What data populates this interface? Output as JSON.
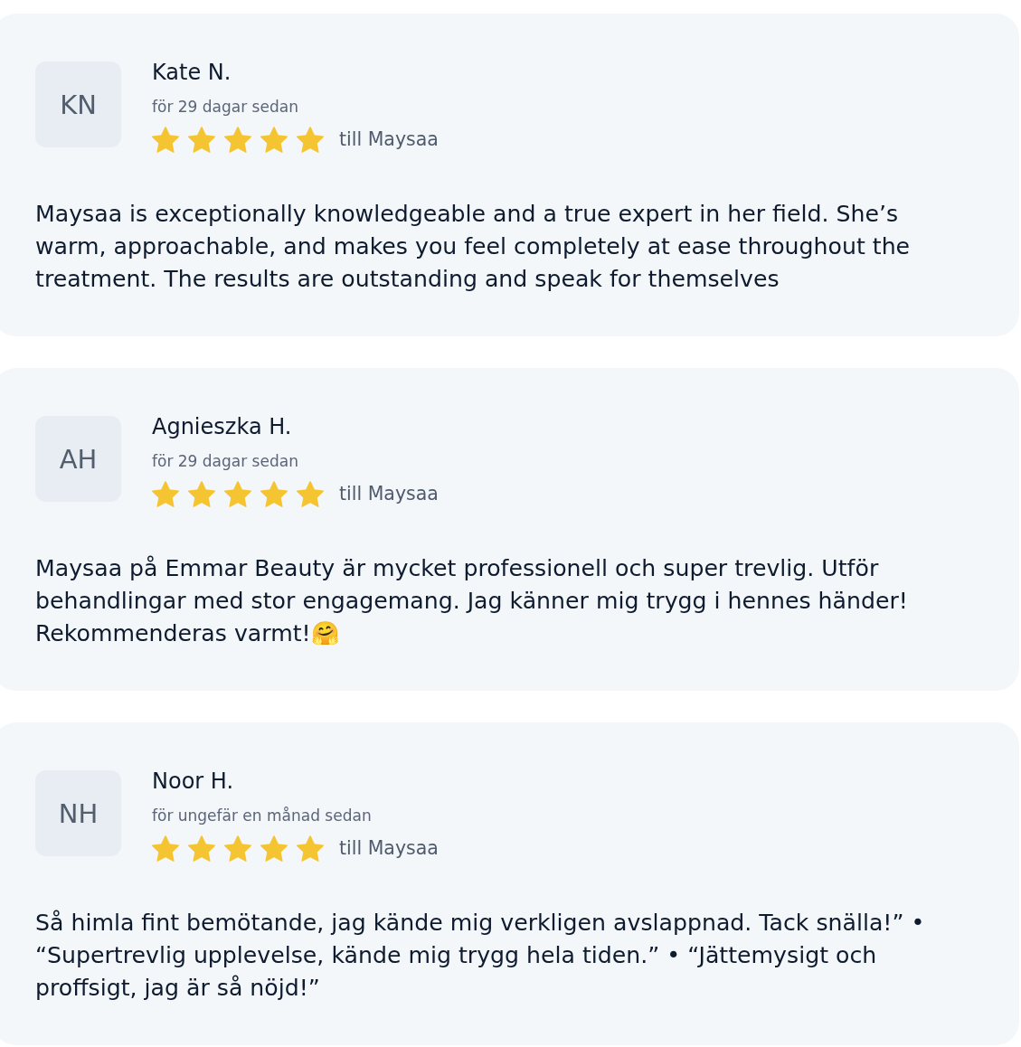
{
  "reviews": [
    {
      "initials": "KN",
      "name": "Kate N.",
      "time": "för 29 dagar sedan",
      "stars": 5,
      "recipient": "till Maysaa",
      "text": "Maysaa is exceptionally knowledgeable and a true expert in her field. She’s warm, approachable, and makes you feel completely at ease throughout the treatment. The results are outstanding and speak for themselves"
    },
    {
      "initials": "AH",
      "name": "Agnieszka H.",
      "time": "för 29 dagar sedan",
      "stars": 5,
      "recipient": "till Maysaa",
      "text": "Maysaa på Emmar Beauty är mycket professionell och super trevlig. Utför behandlingar med stor engagemang. Jag känner mig trygg i hennes händer! Rekommenderas varmt!🤗"
    },
    {
      "initials": "NH",
      "name": "Noor H.",
      "time": "för ungefär en månad sedan",
      "stars": 5,
      "recipient": "till Maysaa",
      "text": "Så himla fint bemötande, jag kände mig verkligen avslappnad. Tack snälla!” • “Supertrevlig upplevelse, kände mig trygg hela tiden.” • “Jättemysigt och proffsigt, jag är så nöjd!”"
    }
  ]
}
